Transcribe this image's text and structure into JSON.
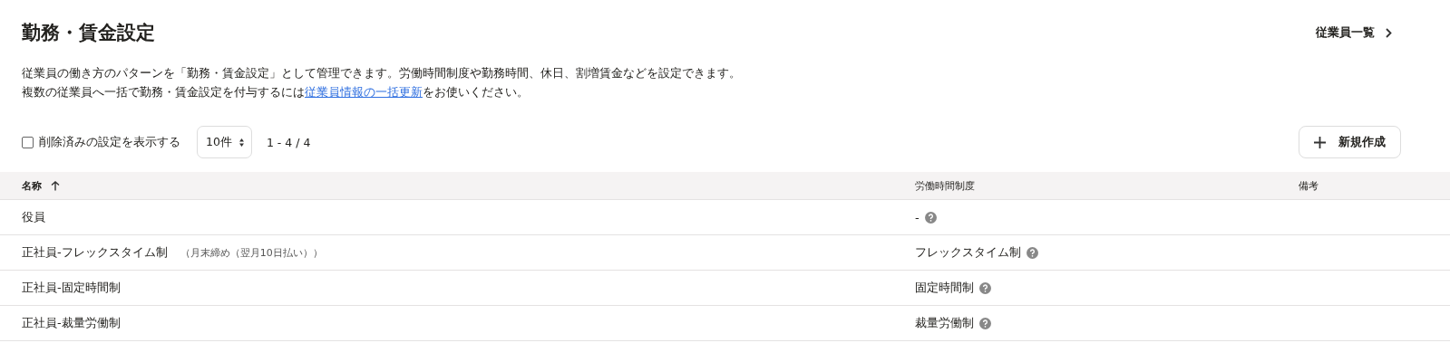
{
  "title": "勤務・賃金設定",
  "header_link": {
    "label": "従業員一覧"
  },
  "description": {
    "line1": "従業員の働き方のパターンを「勤務・賃金設定」として管理できます。労働時間制度や勤務時間、休日、割増賃金などを設定できます。",
    "before": "複数の従業員へ一括で勤務・賃金設定を付与するには",
    "link": "従業員情報の一括更新",
    "after": "をお使いください。"
  },
  "toolbar": {
    "show_deleted": {
      "label": "削除済みの設定を表示する",
      "checked": false
    },
    "per_page": "10件",
    "range": "1 - 4 / 4",
    "new_button": "新規作成"
  },
  "table": {
    "columns": [
      {
        "label": "名称",
        "sorted": true
      },
      {
        "label": "労働時間制度",
        "sorted": false
      },
      {
        "label": "備考",
        "sorted": false
      }
    ],
    "rows": [
      {
        "name": "役員",
        "labor_system": "-"
      },
      {
        "name": "正社員-フレックスタイム制",
        "note": "（月末締め（翌月10日払い））",
        "labor_system": "フレックスタイム制"
      },
      {
        "name": "正社員-固定時間制",
        "labor_system": "固定時間制"
      },
      {
        "name": "正社員-裁量労働制",
        "labor_system": "裁量労働制"
      }
    ]
  }
}
